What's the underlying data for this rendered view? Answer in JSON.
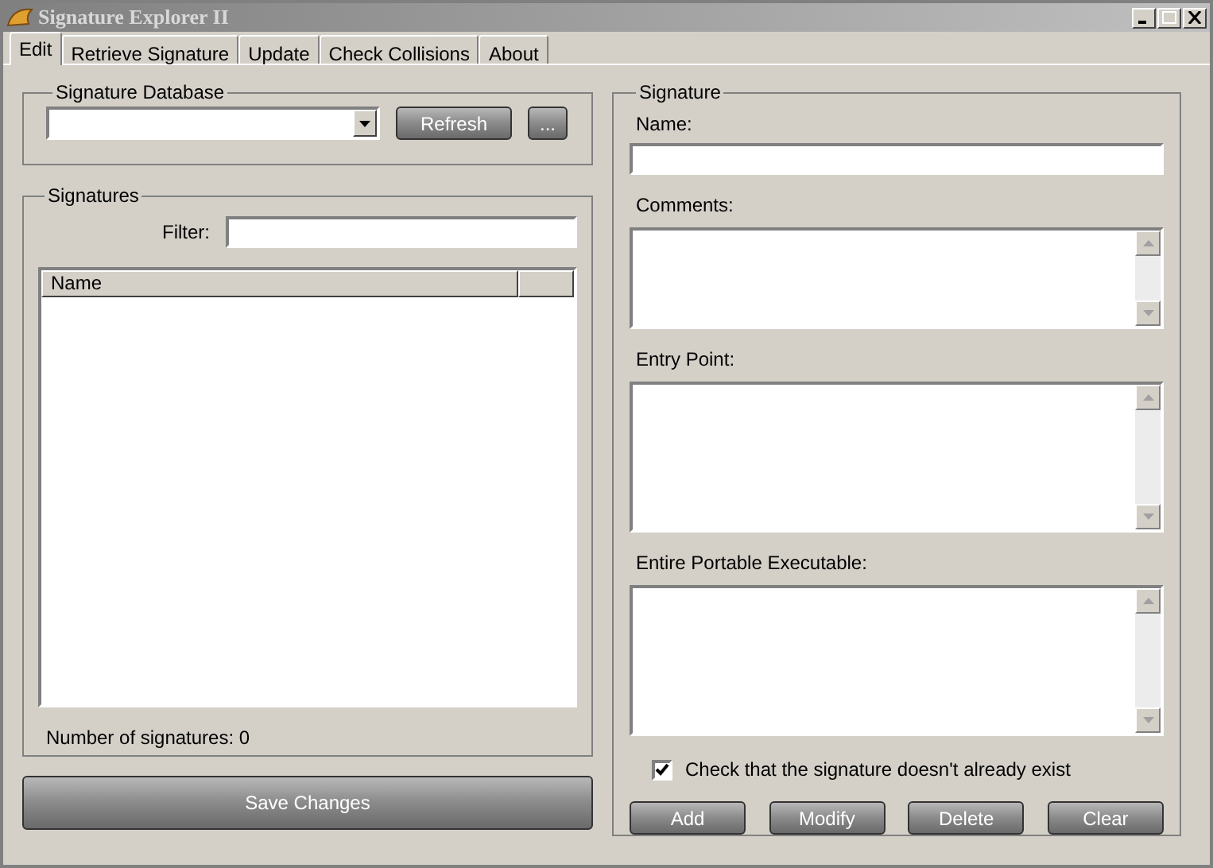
{
  "window": {
    "title": "Signature Explorer II"
  },
  "tabs": [
    {
      "label": "Edit",
      "selected": true
    },
    {
      "label": "Retrieve Signature",
      "selected": false
    },
    {
      "label": "Update",
      "selected": false
    },
    {
      "label": "Check Collisions",
      "selected": false
    },
    {
      "label": "About",
      "selected": false
    }
  ],
  "database": {
    "title": "Signature Database",
    "refresh": "Refresh",
    "browse": "..."
  },
  "signatures": {
    "title": "Signatures",
    "filter_label": "Filter:",
    "columns": [
      "Name"
    ],
    "count": "Number of signatures: 0"
  },
  "save": "Save Changes",
  "signature": {
    "title": "Signature",
    "name_label": "Name:",
    "fields": [
      {
        "label": "Comments:"
      },
      {
        "label": "Entry Point:"
      },
      {
        "label": "Entire Portable Executable:"
      }
    ],
    "check": {
      "label": "Check that the signature doesn't already exist",
      "checked": true
    },
    "buttons": [
      "Add",
      "Modify",
      "Delete",
      "Clear"
    ]
  }
}
